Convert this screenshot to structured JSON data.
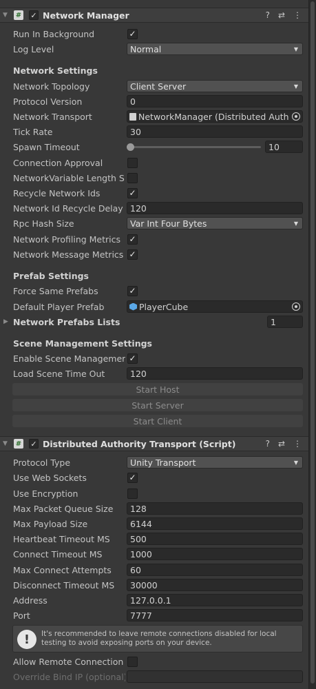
{
  "network_manager": {
    "title": "Network Manager",
    "run_in_background_label": "Run In Background",
    "log_level_label": "Log Level",
    "log_level_value": "Normal",
    "network_settings_header": "Network Settings",
    "network_topology_label": "Network Topology",
    "network_topology_value": "Client Server",
    "protocol_version_label": "Protocol Version",
    "protocol_version_value": "0",
    "network_transport_label": "Network Transport",
    "network_transport_value": "NetworkManager (Distributed Auth",
    "tick_rate_label": "Tick Rate",
    "tick_rate_value": "30",
    "spawn_timeout_label": "Spawn Timeout",
    "spawn_timeout_value": "10",
    "connection_approval_label": "Connection Approval",
    "networkvariable_length_label": "NetworkVariable Length S",
    "recycle_network_ids_label": "Recycle Network Ids",
    "network_id_recycle_delay_label": "Network Id Recycle Delay",
    "network_id_recycle_delay_value": "120",
    "rpc_hash_size_label": "Rpc Hash Size",
    "rpc_hash_size_value": "Var Int Four Bytes",
    "network_profiling_metrics_label": "Network Profiling Metrics",
    "network_message_metrics_label": "Network Message Metrics",
    "prefab_settings_header": "Prefab Settings",
    "force_same_prefabs_label": "Force Same Prefabs",
    "default_player_prefab_label": "Default Player Prefab",
    "default_player_prefab_value": "PlayerCube",
    "network_prefabs_lists_label": "Network Prefabs Lists",
    "network_prefabs_lists_count": "1",
    "scene_management_header": "Scene Management Settings",
    "enable_scene_management_label": "Enable Scene Managemer",
    "load_scene_timeout_label": "Load Scene Time Out",
    "load_scene_timeout_value": "120",
    "start_host_label": "Start Host",
    "start_server_label": "Start Server",
    "start_client_label": "Start Client"
  },
  "transport": {
    "title": "Distributed Authority Transport (Script)",
    "protocol_type_label": "Protocol Type",
    "protocol_type_value": "Unity Transport",
    "use_web_sockets_label": "Use Web Sockets",
    "use_encryption_label": "Use Encryption",
    "max_packet_queue_size_label": "Max Packet Queue Size",
    "max_packet_queue_size_value": "128",
    "max_payload_size_label": "Max Payload Size",
    "max_payload_size_value": "6144",
    "heartbeat_timeout_label": "Heartbeat Timeout MS",
    "heartbeat_timeout_value": "500",
    "connect_timeout_label": "Connect Timeout MS",
    "connect_timeout_value": "1000",
    "max_connect_attempts_label": "Max Connect Attempts",
    "max_connect_attempts_value": "60",
    "disconnect_timeout_label": "Disconnect Timeout MS",
    "disconnect_timeout_value": "30000",
    "address_label": "Address",
    "address_value": "127.0.0.1",
    "port_label": "Port",
    "port_value": "7777",
    "help_text": "It's recommended to leave remote connections disabled for local testing to avoid exposing ports on your device.",
    "allow_remote_connection_label": "Allow Remote Connection",
    "override_bind_ip_label": "Override Bind IP (optional)"
  },
  "icons": {
    "help": "?",
    "presets": "⇄",
    "more": "⋮",
    "check": "✓",
    "fold": "▼",
    "collapsed": "▶",
    "dropdown_arrow": "▼",
    "warning": "!",
    "script": "#"
  }
}
